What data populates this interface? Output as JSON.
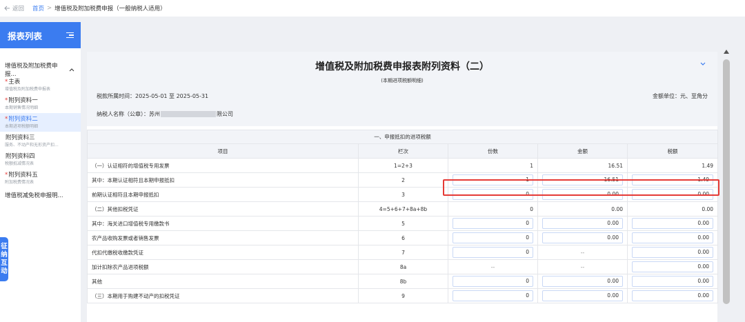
{
  "topbar": {
    "back_label": "返回",
    "home_label": "首页",
    "separator": ">",
    "current": "增值税及附加税费申报（一般纳税人适用）"
  },
  "sidebar": {
    "title": "报表列表",
    "group_label": "增值税及附加税费申报...",
    "items": [
      {
        "star": "*",
        "name": "主表",
        "sub": "增值税及附加税费申报表"
      },
      {
        "star": "*",
        "name": "附列资料一",
        "sub": "本期销售情况明细"
      },
      {
        "star": "*",
        "name": "附列资料二",
        "sub": "本期进项税额明细"
      },
      {
        "star": "",
        "name": "附列资料三",
        "sub": "服务、不动产和无形资产扣..."
      },
      {
        "star": "",
        "name": "附列资料四",
        "sub": "税额抵减情况表"
      },
      {
        "star": "*",
        "name": "附列资料五",
        "sub": "附加税费情况表"
      }
    ],
    "last_item": "增值税减免税申报明..."
  },
  "float_tab": [
    "征",
    "纳",
    "互",
    "动"
  ],
  "form": {
    "title": "增值税及附加税费申报表附列资料（二）",
    "subtitle": "(本期进项税额明细)",
    "period_label": "税款所属时间：",
    "period_value": "2025-05-01 至 2025-05-31",
    "unit": "金额单位：元、至角分",
    "taxpayer_label": "纳税人名称（公章）：",
    "taxpayer_prefix": "苏州",
    "taxpayer_suffix": "限公司"
  },
  "table": {
    "section": "一、申报抵扣的进项税额",
    "headers": {
      "item": "项目",
      "col": "栏次",
      "count": "份数",
      "amount": "金额",
      "tax": "税额"
    },
    "rows": [
      {
        "item": "（一）认证相符的增值税专用发票",
        "col": "1=2+3",
        "count": "1",
        "amount": "16.51",
        "tax": "1.49"
      },
      {
        "item": "其中：本期认证相符且本期申报抵扣",
        "col": "2",
        "count": "1",
        "amount": "16.51",
        "tax": "1.49"
      },
      {
        "item": "前期认证相符且本期申报抵扣",
        "col": "3",
        "count": "0",
        "amount": "0.00",
        "tax": "0.00"
      },
      {
        "item": "（二）其他扣税凭证",
        "col": "4=5+6+7+8a+8b",
        "count": "0",
        "amount": "0.00",
        "tax": "0.00"
      },
      {
        "item": "其中：海关进口增值税专用缴款书",
        "col": "5",
        "count": "0",
        "amount": "0.00",
        "tax": "0.00"
      },
      {
        "item": "农产品收购发票或者销售发票",
        "col": "6",
        "count": "0",
        "amount": "0.00",
        "tax": "0.00"
      },
      {
        "item": "代扣代缴税收缴款凭证",
        "col": "7",
        "count": "0",
        "amount": "--",
        "tax": "0.00"
      },
      {
        "item": "加计扣除农产品进项税额",
        "col": "8a",
        "count": "--",
        "amount": "--",
        "tax": "0.00"
      },
      {
        "item": "其他",
        "col": "8b",
        "count": "0",
        "amount": "0.00",
        "tax": "0.00"
      },
      {
        "item": "（三）本期用于购建不动产的扣税凭证",
        "col": "9",
        "count": "0",
        "amount": "0.00",
        "tax": "0.00"
      }
    ]
  },
  "colors": {
    "accent": "#3b7cf0",
    "highlight": "#e53935"
  }
}
